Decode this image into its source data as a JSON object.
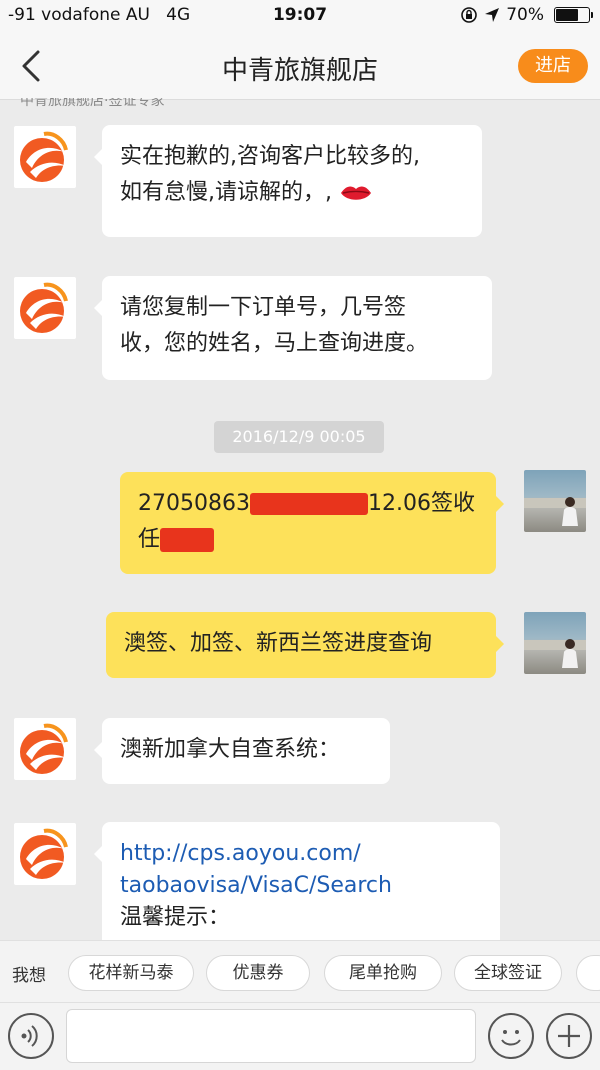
{
  "status": {
    "carrier": "-91 vodafone AU",
    "network": "4G",
    "time": "19:07",
    "battery": "70%",
    "battery_level": 0.7
  },
  "nav": {
    "title": "中青旅旗舰店",
    "enter_label": "进店",
    "cut_text": "中青旅旗舰店·签证专家"
  },
  "messages": {
    "m1_line1": "实在抱歉的,咨询客户比较多的,",
    "m1_line2": "如有怠慢,请谅解的，,",
    "m2_line1": "请您复制一下订单号，几号签",
    "m2_line2": "收，您的姓名，马上查询进度。",
    "timestamp": "2016/12/9 00:05",
    "m3_prefix": "27050863",
    "m3_suffix": "12.06签收",
    "m3_line2": "任",
    "m4": "澳签、加签、新西兰签进度查询",
    "m5": "澳新加拿大自查系统：",
    "m6_link1": "http://cps.aoyou.com/",
    "m6_link2": "taobaovisa/VisaC/Search",
    "m6_line3": "温馨提示："
  },
  "quick": {
    "label": "我想",
    "chips": [
      "花样新马泰",
      "优惠券",
      "尾单抢购",
      "全球签证"
    ]
  },
  "colors": {
    "accent": "#f88c1b",
    "outgoing_bubble": "#fde15a",
    "link": "#1d5cb3",
    "redaction": "#e8341c"
  }
}
